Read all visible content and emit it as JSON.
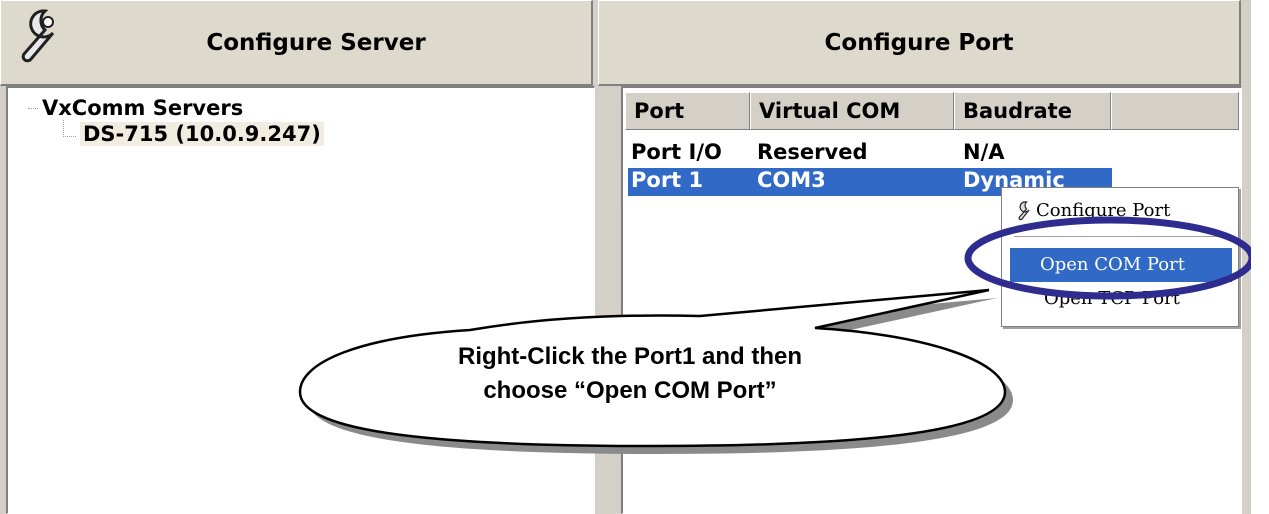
{
  "server_panel": {
    "title": "Configure Server",
    "tree": {
      "root_label": "VxComm Servers",
      "child_label": "DS-715 (10.0.9.247)"
    }
  },
  "port_panel": {
    "title": "Configure Port",
    "columns": [
      "Port",
      "Virtual COM",
      "Baudrate"
    ],
    "rows": [
      {
        "port": "Port I/O",
        "virtual_com": "Reserved",
        "baudrate": "N/A",
        "selected": false
      },
      {
        "port": "Port 1",
        "virtual_com": "COM3",
        "baudrate": "Dynamic",
        "selected": true
      }
    ]
  },
  "context_menu": {
    "items": [
      {
        "label": "Configure Port",
        "icon": "wrench-icon"
      },
      {
        "label": "Open COM Port",
        "highlighted": true
      },
      {
        "label": "Open TCP Port"
      }
    ]
  },
  "annotation": {
    "callout_line1": "Right-Click the Port1 and then",
    "callout_line2": "choose “Open COM Port”",
    "highlight_color": "#2e2d8f"
  },
  "colors": {
    "selection": "#3169c6",
    "window_bg": "#d4d0c8"
  }
}
